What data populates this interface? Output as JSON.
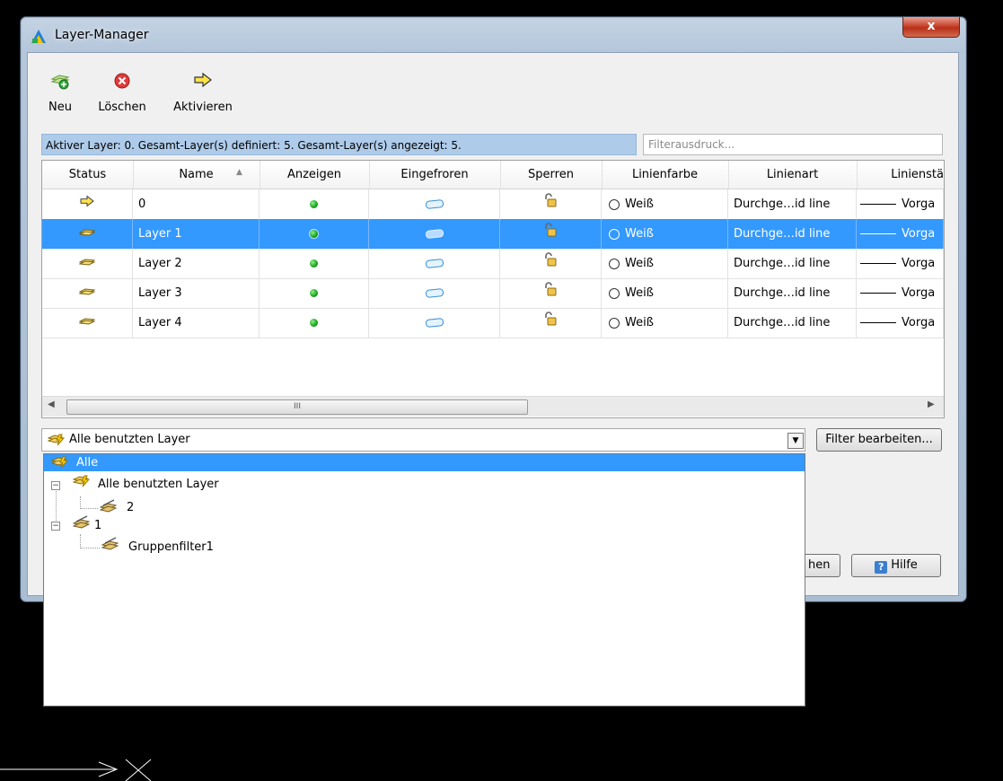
{
  "window": {
    "title": "Layer-Manager",
    "close_glyph": "x"
  },
  "toolbar": {
    "new_label": "Neu",
    "delete_label": "Löschen",
    "activate_label": "Aktivieren"
  },
  "info_bar": {
    "text": "Aktiver Layer: 0. Gesamt-Layer(s) definiert: 5. Gesamt-Layer(s) angezeigt: 5."
  },
  "filter": {
    "placeholder": "Filterausdruck..."
  },
  "table": {
    "columns": [
      "Status",
      "Name",
      "Anzeigen",
      "Eingefroren",
      "Sperren",
      "Linienfarbe",
      "Linienart",
      "Linienstä"
    ],
    "rows": [
      {
        "name": "0",
        "color": "Weiß",
        "linetype": "Durchge…id line",
        "lineweight": "Vorga",
        "selected": false,
        "active": true
      },
      {
        "name": "Layer 1",
        "color": "Weiß",
        "linetype": "Durchge…id line",
        "lineweight": "Vorga",
        "selected": true,
        "active": false
      },
      {
        "name": "Layer 2",
        "color": "Weiß",
        "linetype": "Durchge…id line",
        "lineweight": "Vorga",
        "selected": false,
        "active": false
      },
      {
        "name": "Layer 3",
        "color": "Weiß",
        "linetype": "Durchge…id line",
        "lineweight": "Vorga",
        "selected": false,
        "active": false
      },
      {
        "name": "Layer 4",
        "color": "Weiß",
        "linetype": "Durchge…id line",
        "lineweight": "Vorga",
        "selected": false,
        "active": false
      }
    ],
    "scroll_grip": "III"
  },
  "filter_combo": {
    "selected": "Alle benutzten Layer"
  },
  "buttons": {
    "edit_filter": "Filter bearbeiten...",
    "partial_button": "hen",
    "help": "Hilfe",
    "help_glyph": "?"
  },
  "dropdown": {
    "items": [
      {
        "label": "Alle"
      },
      {
        "label": "Alle benutzten Layer"
      },
      {
        "label": "2"
      },
      {
        "label": "1"
      },
      {
        "label": "Gruppenfilter1"
      }
    ]
  },
  "colors": {
    "selection": "#3399ff",
    "info_bar": "#aecbea",
    "background": "#000000"
  }
}
